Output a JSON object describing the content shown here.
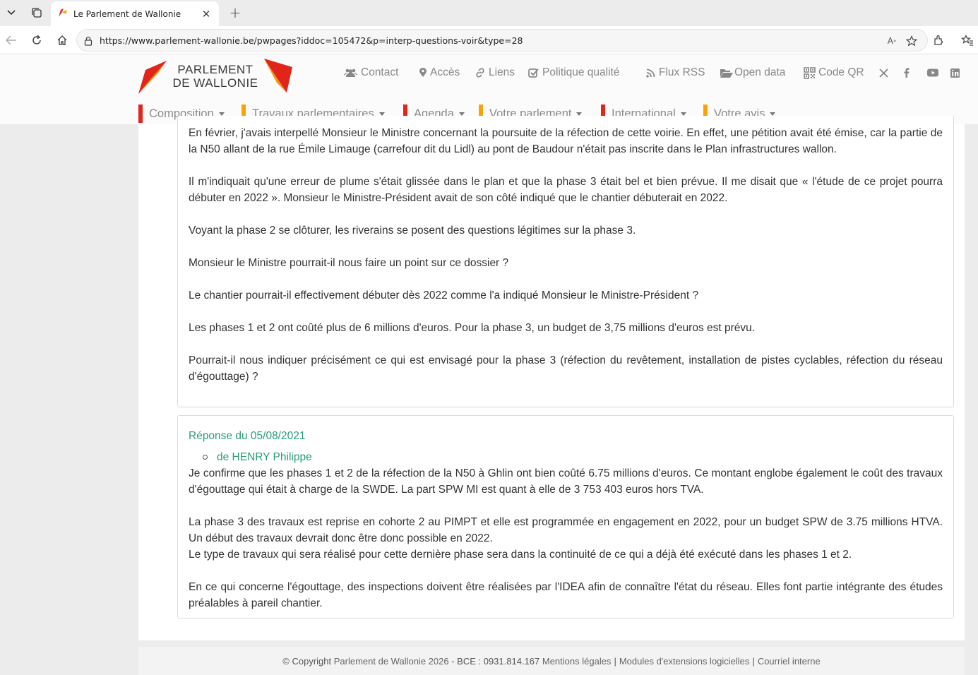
{
  "browser": {
    "tab_title": "Le Parlement de Wallonie",
    "url": "https://www.parlement-wallonie.be/pwpages?iddoc=105472&p=interp-questions-voir&type=28"
  },
  "site": {
    "logo_line1": "PARLEMENT",
    "logo_line2": "DE WALLONIE",
    "brand_colors": {
      "red": "#e1251b",
      "yellow": "#f7a30a",
      "reply_green": "#2a9b7a"
    },
    "topnav": [
      {
        "label": "Contact",
        "icon": "users-icon"
      },
      {
        "label": "Accès",
        "icon": "map-marker-icon"
      },
      {
        "label": "Liens",
        "icon": "link-icon"
      },
      {
        "label": "Politique qualité",
        "icon": "check-square-icon"
      },
      {
        "label": "Flux RSS",
        "icon": "rss-icon"
      },
      {
        "label": "Open data",
        "icon": "folder-open-icon"
      },
      {
        "label": "Code QR",
        "icon": "qrcode-icon"
      }
    ],
    "social": [
      "x-icon",
      "facebook-icon",
      "youtube-icon",
      "linkedin-icon"
    ],
    "mainnav": [
      {
        "label": "Composition",
        "bar": "#e1251b"
      },
      {
        "label": "Travaux parlementaires",
        "bar": "#f7a30a"
      },
      {
        "label": "Agenda",
        "bar": "#e1251b"
      },
      {
        "label": "Votre parlement",
        "bar": "#f7a30a"
      },
      {
        "label": "International",
        "bar": "#e1251b"
      },
      {
        "label": "Votre avis",
        "bar": "#f7a30a"
      }
    ]
  },
  "question": {
    "paragraphs": [
      "En février, j'avais interpellé Monsieur le Ministre concernant la poursuite de la réfection de cette voirie. En effet, une pétition avait été émise, car la partie de la N50 allant de la rue Émile Limauge (carrefour dit du Lidl) au pont de Baudour n'était pas inscrite dans le Plan infrastructures wallon.",
      "Il m'indiquait qu'une erreur de plume s'était glissée dans le plan et que la phase 3 était bel et bien prévue. Il me disait que « l'étude de ce projet pourra débuter en 2022 ». Monsieur le Ministre-Président avait de son côté indiqué que le chantier débuterait en 2022.",
      "Voyant la phase 2 se clôturer, les riverains se posent des questions légitimes sur la phase 3.",
      "Monsieur le Ministre pourrait-il nous faire un point sur ce dossier ?",
      "Le chantier pourrait-il effectivement débuter dès 2022 comme l'a indiqué Monsieur le Ministre-Président ?",
      "Les phases 1 et 2 ont coûté plus de 6 millions d'euros. Pour la phase 3, un budget de 3,75 millions d'euros est prévu.",
      "Pourrait-il nous indiquer précisément ce qui est envisagé pour la phase 3 (réfection du revêtement, installation de pistes cyclables, réfection du réseau d'égouttage) ?"
    ]
  },
  "reply": {
    "title": "Réponse du 05/08/2021",
    "author": "de HENRY Philippe",
    "p1": "Je confirme que les phases 1 et 2 de la réfection de la N50 à Ghlin ont bien coûté 6.75 millions d'euros. Ce montant englobe également le coût des travaux d'égouttage qui était à charge de la SWDE. La part SPW MI est quant à elle de 3 753 403 euros hors TVA.",
    "p2": "La phase 3 des travaux est reprise en cohorte 2 au PIMPT et elle est programmée en engagement en 2022, pour un budget SPW de 3.75 millions HTVA. Un début des travaux devrait donc être donc possible en 2022.",
    "p3": "Le type de travaux qui sera réalisé pour cette dernière phase sera dans la continuité de ce qui a déjà été exécuté dans les phases 1 et 2.",
    "p4": "En ce qui concerne l'égouttage, des inspections doivent être réalisées par l'IDEA afin de connaître l'état du réseau. Elles font partie intégrante des études préalables à pareil chantier."
  },
  "footer": {
    "copyright": "© Copyright",
    "org": "Parlement de Wallonie 2026",
    "bce": "- BCE : 0931.814.167",
    "mentions": "Mentions légales",
    "modules": "Modules d'extensions logicielles",
    "courriel": "Courriel interne",
    "sep": "|"
  }
}
